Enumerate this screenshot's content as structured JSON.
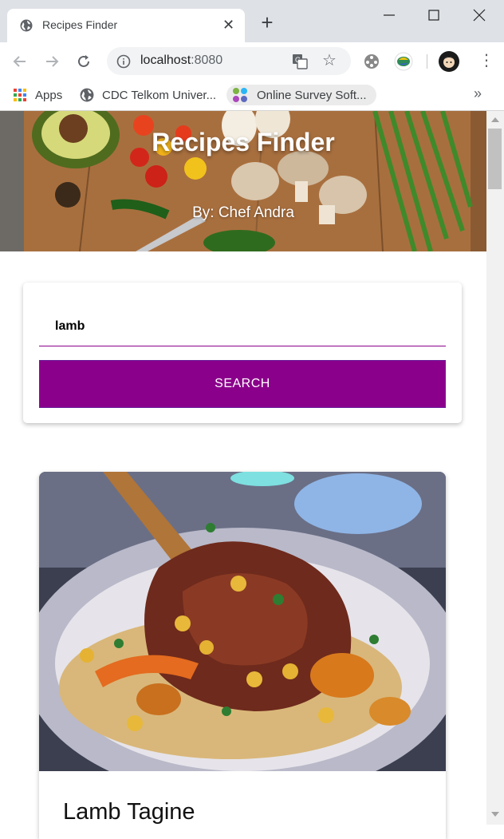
{
  "browser": {
    "tab_title": "Recipes Finder",
    "url_host": "localhost",
    "url_port": ":8080",
    "bookmarks": [
      {
        "label": "Apps"
      },
      {
        "label": "CDC Telkom Univer..."
      },
      {
        "label": "Online Survey Soft..."
      }
    ],
    "more_bookmarks": "»"
  },
  "hero": {
    "title": "Recipes Finder",
    "subtitle": "By: Chef Andra"
  },
  "search": {
    "value": "lamb",
    "button_label": "SEARCH"
  },
  "results": [
    {
      "title": "Lamb Tagine"
    }
  ],
  "colors": {
    "accent": "#8b008b",
    "chrome_bg": "#dee1e6"
  }
}
